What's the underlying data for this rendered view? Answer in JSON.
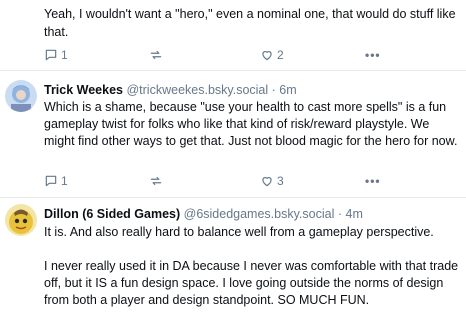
{
  "posts": [
    {
      "text": "Yeah, I wouldn't want a \"hero,\" even a nominal one, that would do stuff like that.",
      "reply_count": "1",
      "repost_count": "",
      "like_count": "2",
      "more_label": "•••"
    },
    {
      "display_name": "Trick Weekes",
      "handle": "@trickweekes.bsky.social",
      "separator": "·",
      "time": "6m",
      "text": "Which is a shame, because \"use your health to cast more spells\" is a fun gameplay twist for folks who like that kind of risk/reward playstyle. We might find other ways to get that. Just not blood magic for the hero for now.",
      "reply_count": "1",
      "repost_count": "",
      "like_count": "3",
      "more_label": "•••",
      "avatar_color": "#8fb4e0"
    },
    {
      "display_name": "Dillon (6 Sided Games)",
      "handle": "@6sidedgames.bsky.social",
      "separator": "·",
      "time": "4m",
      "paragraphs": [
        "It is. And also really hard to balance well from a gameplay perspective.",
        "I never really used it in DA because I never was comfortable with that trade off, but it IS a fun design space. I love going outside the norms of design from both a player and design standpoint. SO MUCH FUN."
      ],
      "avatar_color": "#e8c23a"
    }
  ],
  "colors": {
    "text": "#0b0f14",
    "muted": "#66788a",
    "divider": "#e6e9ee",
    "background": "#ffffff"
  },
  "icons": {
    "reply": "reply-icon",
    "repost": "repost-icon",
    "like": "heart-icon",
    "more": "more-icon"
  }
}
